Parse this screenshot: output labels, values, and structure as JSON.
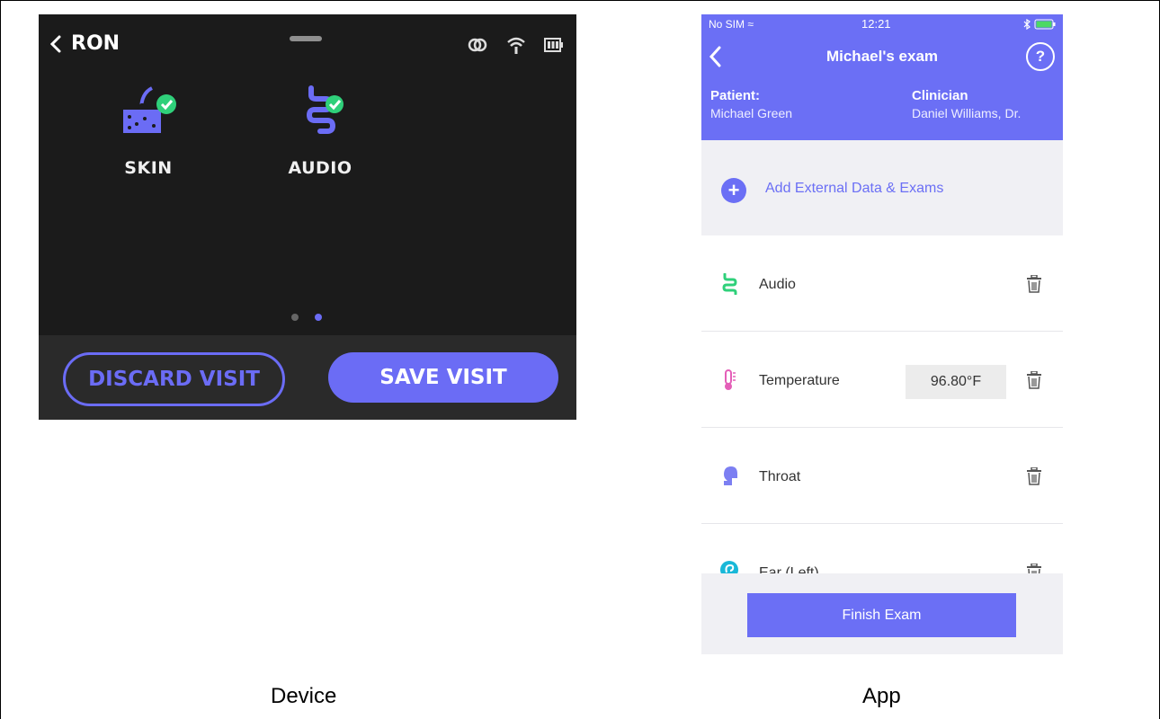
{
  "device": {
    "back_label": "RON",
    "tiles": [
      {
        "label": "SKIN",
        "icon": "skin-icon"
      },
      {
        "label": "AUDIO",
        "icon": "audio-icon"
      }
    ],
    "discard_label": "DISCARD VISIT",
    "save_label": "SAVE VISIT",
    "page_indicator": {
      "count": 2,
      "active": 1
    }
  },
  "app": {
    "status": {
      "carrier": "No SIM",
      "time": "12:21"
    },
    "title": "Michael's exam",
    "help": "?",
    "patient_label": "Patient:",
    "patient_name": "Michael Green",
    "clinician_label": "Clinician",
    "clinician_name": "Daniel Williams, Dr.",
    "add_label": "Add External Data & Exams",
    "exams": [
      {
        "name": "Audio",
        "icon": "intestine-icon",
        "value": ""
      },
      {
        "name": "Temperature",
        "icon": "thermometer-icon",
        "value": "96.80°F"
      },
      {
        "name": "Throat",
        "icon": "head-profile-icon",
        "value": ""
      },
      {
        "name": "Ear (Left)",
        "icon": "ear-icon",
        "value": ""
      }
    ],
    "finish_label": "Finish Exam"
  },
  "captions": {
    "device": "Device",
    "app": "App"
  },
  "colors": {
    "accent": "#6b6ff5",
    "device_bg": "#1b1b1b",
    "check": "#2fd07a"
  }
}
